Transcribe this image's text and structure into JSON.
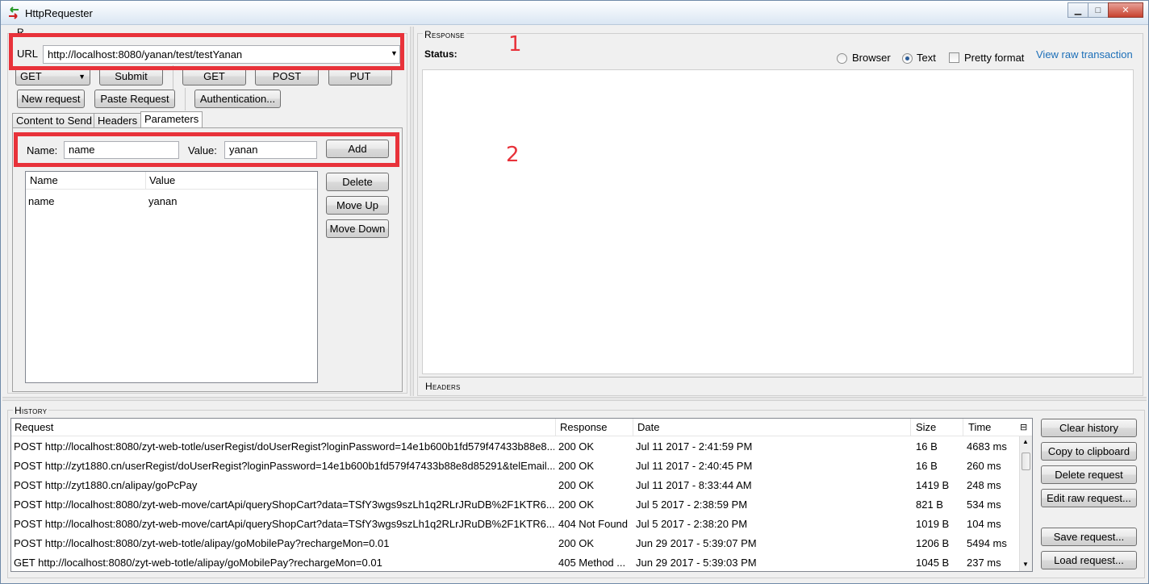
{
  "window": {
    "title": "HttpRequester",
    "minimize_glyph": "▁",
    "maximize_glyph": "□",
    "close_glyph": "✕"
  },
  "request": {
    "group_title": "R",
    "url_label": "URL",
    "url_value": "http://localhost:8080/yanan/test/testYanan",
    "method_selected": "GET",
    "submit_label": "Submit",
    "get_label": "GET",
    "post_label": "POST",
    "put_label": "PUT",
    "new_request_label": "New request",
    "paste_request_label": "Paste Request",
    "authentication_label": "Authentication...",
    "tabs": [
      "Content to Send",
      "Headers",
      "Parameters"
    ],
    "active_tab": "Parameters",
    "param_name_label": "Name:",
    "param_name_value": "name",
    "param_value_label": "Value:",
    "param_value_value": "yanan",
    "add_label": "Add",
    "params_columns": [
      "Name",
      "Value"
    ],
    "params_rows": [
      [
        "name",
        "yanan"
      ]
    ],
    "delete_label": "Delete",
    "move_up_label": "Move Up",
    "move_down_label": "Move Down"
  },
  "response": {
    "group_title": "Response",
    "status_label": "Status:",
    "view_options": [
      "Browser",
      "Text"
    ],
    "view_selected": "Text",
    "pretty_format_label": "Pretty format",
    "pretty_format_checked": false,
    "view_raw_label": "View raw transaction",
    "headers_title": "Headers"
  },
  "annotations": [
    "1",
    "2"
  ],
  "history": {
    "group_title": "History",
    "columns": [
      "Request",
      "Response",
      "Date",
      "Size",
      "Time"
    ],
    "rows": [
      [
        "POST http://localhost:8080/zyt-web-totle/userRegist/doUserRegist?loginPassword=14e1b600b1fd579f47433b88e8...",
        "200 OK",
        "Jul 11 2017 - 2:41:59 PM",
        "16 B",
        "4683 ms"
      ],
      [
        "POST http://zyt1880.cn/userRegist/doUserRegist?loginPassword=14e1b600b1fd579f47433b88e8d85291&telEmail...",
        "200 OK",
        "Jul 11 2017 - 2:40:45 PM",
        "16 B",
        "260 ms"
      ],
      [
        "POST http://zyt1880.cn/alipay/goPcPay",
        "200 OK",
        "Jul 11 2017 - 8:33:44 AM",
        "1419 B",
        "248 ms"
      ],
      [
        "POST http://localhost:8080/zyt-web-move/cartApi/queryShopCart?data=TSfY3wgs9szLh1q2RLrJRuDB%2F1KTR6...",
        "200 OK",
        "Jul 5 2017 - 2:38:59 PM",
        "821 B",
        "534 ms"
      ],
      [
        "POST http://localhost:8080/zyt-web-move/cartApi/queryShopCart?data=TSfY3wgs9szLh1q2RLrJRuDB%2F1KTR6...",
        "404 Not Found",
        "Jul 5 2017 - 2:38:20 PM",
        "1019 B",
        "104 ms"
      ],
      [
        "POST http://localhost:8080/zyt-web-totle/alipay/goMobilePay?rechargeMon=0.01",
        "200 OK",
        "Jun 29 2017 - 5:39:07 PM",
        "1206 B",
        "5494 ms"
      ],
      [
        "GET http://localhost:8080/zyt-web-totle/alipay/goMobilePay?rechargeMon=0.01",
        "405 Method ...",
        "Jun 29 2017 - 5:39:03 PM",
        "1045 B",
        "237 ms"
      ]
    ],
    "clear_history_label": "Clear history",
    "copy_clipboard_label": "Copy to clipboard",
    "delete_request_label": "Delete request",
    "edit_raw_label": "Edit raw request...",
    "save_request_label": "Save request...",
    "load_request_label": "Load request..."
  }
}
